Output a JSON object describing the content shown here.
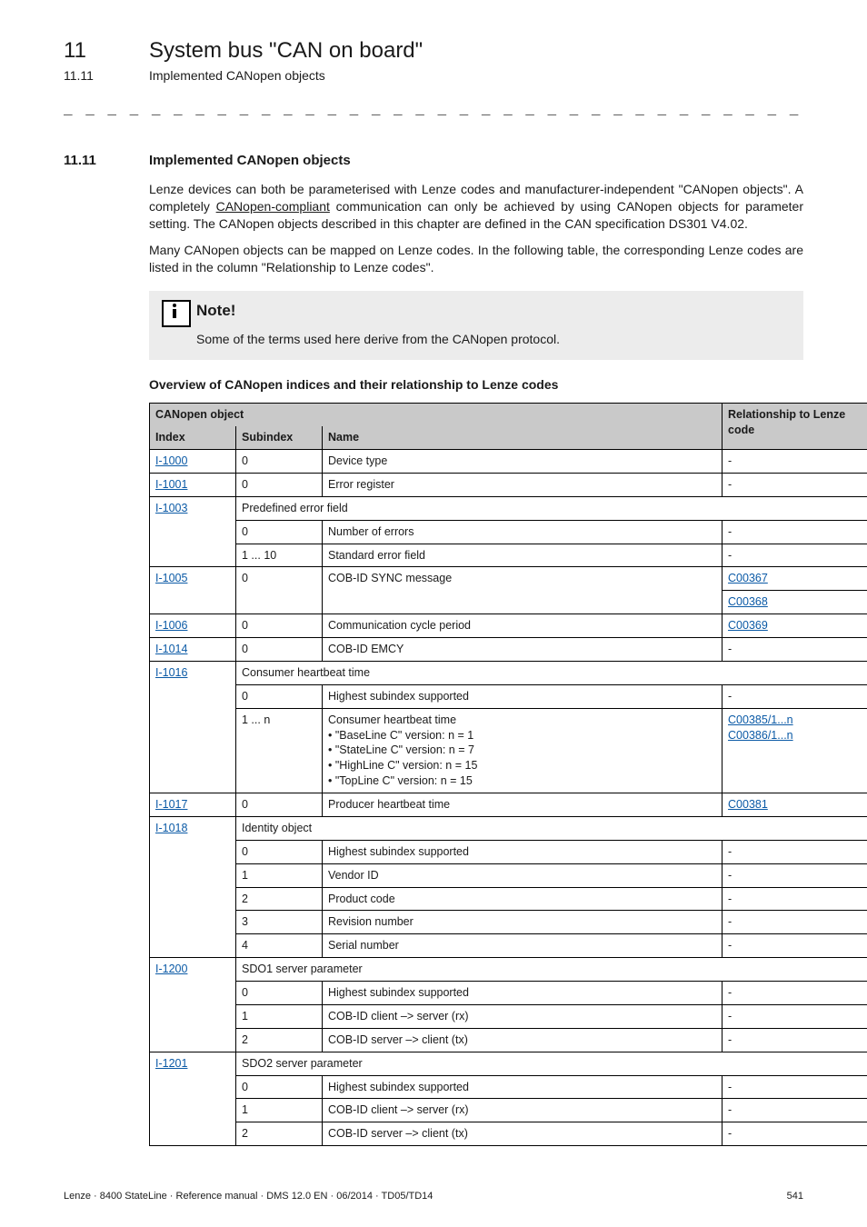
{
  "chapter": {
    "num": "11",
    "title": "System bus \"CAN on board\""
  },
  "subsection_top": {
    "num": "11.11",
    "title": "Implemented CANopen objects"
  },
  "dashes": "_ _ _ _ _ _ _ _ _ _ _ _ _ _ _ _ _ _ _ _ _ _ _ _ _ _ _ _ _ _ _ _ _ _ _ _ _ _ _ _ _ _ _ _ _ _ _ _ _ _ _ _ _ _ _ _ _ _ _ _ _ _ _ _",
  "section": {
    "num": "11.11",
    "title": "Implemented CANopen objects"
  },
  "para1_pre": "Lenze devices can both be parameterised with Lenze codes and manufacturer-independent \"CANopen objects\". A completely ",
  "para1_link": "CANopen-compliant",
  "para1_post": " communication can only be achieved by using CANopen objects for parameter setting. The CANopen objects described in this chapter are defined in the CAN specification DS301 V4.02.",
  "para2": "Many CANopen objects can be mapped on Lenze codes. In the following table, the corresponding Lenze codes are listed in the column \"Relationship to Lenze codes\".",
  "note": {
    "label": "Note!",
    "text": "Some of the terms used here derive from the CANopen protocol."
  },
  "table_title": "Overview of CANopen indices and their relationship to Lenze codes",
  "table": {
    "head": {
      "canopen_object": "CANopen object",
      "index": "Index",
      "subindex": "Subindex",
      "name": "Name",
      "relationship": "Relationship to Lenze code"
    },
    "rows": {
      "r1": {
        "index": "I-1000",
        "sub": "0",
        "name": "Device type",
        "rel": "-"
      },
      "r2": {
        "index": "I-1001",
        "sub": "0",
        "name": "Error register",
        "rel": "-"
      },
      "r3": {
        "index": "I-1003",
        "span": "Predefined error field"
      },
      "r3a": {
        "sub": "0",
        "name": "Number of errors",
        "rel": "-"
      },
      "r3b": {
        "sub": "1 ... 10",
        "name": "Standard error field",
        "rel": "-"
      },
      "r4": {
        "index": "I-1005",
        "sub": "0",
        "name": "COB-ID SYNC message",
        "rel1": "C00367",
        "rel2": "C00368"
      },
      "r5": {
        "index": "I-1006",
        "sub": "0",
        "name": "Communication cycle period",
        "rel": "C00369"
      },
      "r6": {
        "index": "I-1014",
        "sub": "0",
        "name": "COB-ID EMCY",
        "rel": "-"
      },
      "r7": {
        "index": "I-1016",
        "span": "Consumer heartbeat time"
      },
      "r7a": {
        "sub": "0",
        "name": "Highest subindex supported",
        "rel": "-"
      },
      "r7b": {
        "sub": "1 ... n",
        "name_head": "Consumer heartbeat time",
        "b1": "\"BaseLine C\" version: n = 1",
        "b2": "\"StateLine C\" version: n = 7",
        "b3": "\"HighLine C\" version: n = 15",
        "b4": "\"TopLine C\" version: n = 15",
        "rel1": "C00385/1...n",
        "rel2": "C00386/1...n"
      },
      "r8": {
        "index": "I-1017",
        "sub": "0",
        "name": "Producer heartbeat time",
        "rel": "C00381"
      },
      "r9": {
        "index": "I-1018",
        "span": "Identity object"
      },
      "r9a": {
        "sub": "0",
        "name": "Highest subindex supported",
        "rel": "-"
      },
      "r9b": {
        "sub": "1",
        "name": "Vendor ID",
        "rel": "-"
      },
      "r9c": {
        "sub": "2",
        "name": "Product code",
        "rel": "-"
      },
      "r9d": {
        "sub": "3",
        "name": "Revision number",
        "rel": "-"
      },
      "r9e": {
        "sub": "4",
        "name": "Serial number",
        "rel": "-"
      },
      "r10": {
        "index": "I-1200",
        "span": "SDO1 server parameter"
      },
      "r10a": {
        "sub": "0",
        "name": "Highest subindex supported",
        "rel": "-"
      },
      "r10b": {
        "sub": "1",
        "name": "COB-ID client –> server (rx)",
        "rel": "-"
      },
      "r10c": {
        "sub": "2",
        "name": "COB-ID server –> client (tx)",
        "rel": "-"
      },
      "r11": {
        "index": "I-1201",
        "span": "SDO2 server parameter"
      },
      "r11a": {
        "sub": "0",
        "name": "Highest subindex supported",
        "rel": "-"
      },
      "r11b": {
        "sub": "1",
        "name": "COB-ID client –> server (rx)",
        "rel": "-"
      },
      "r11c": {
        "sub": "2",
        "name": "COB-ID server –> client (tx)",
        "rel": "-"
      }
    }
  },
  "footer": {
    "left": "Lenze · 8400 StateLine · Reference manual · DMS 12.0 EN · 06/2014 · TD05/TD14",
    "right": "541"
  }
}
